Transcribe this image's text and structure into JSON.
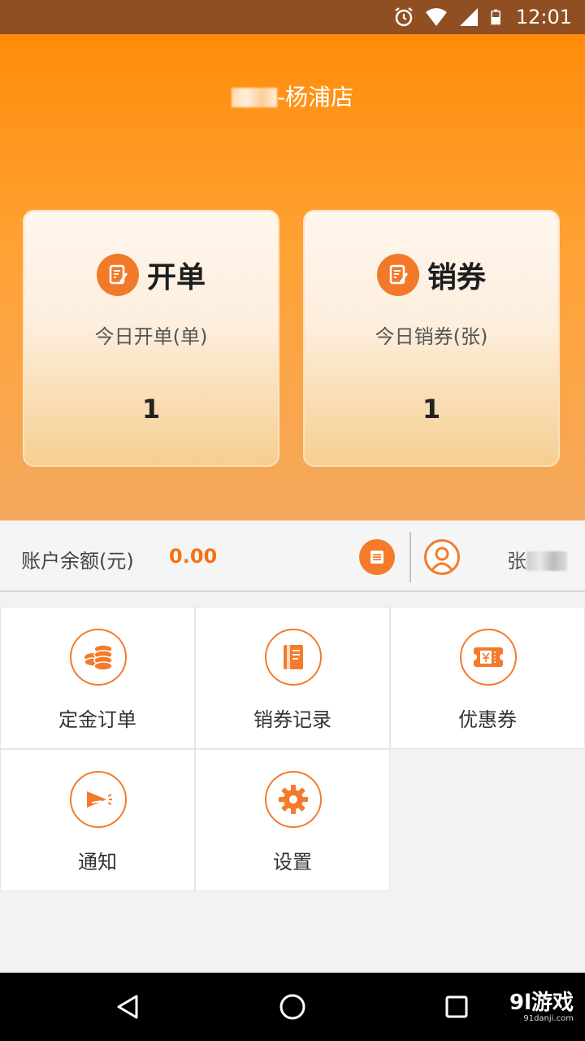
{
  "status_bar": {
    "time": "12:01"
  },
  "header": {
    "store_suffix": "-杨浦店",
    "cards": [
      {
        "title": "开单",
        "subtitle": "今日开单(单)",
        "value": "1",
        "icon": "notepad-icon"
      },
      {
        "title": "销券",
        "subtitle": "今日销券(张)",
        "value": "1",
        "icon": "notepad-icon"
      }
    ]
  },
  "account": {
    "label": "账户余额(元)",
    "value": "0.00",
    "user_prefix": "张"
  },
  "menu": [
    {
      "label": "定金订单",
      "icon": "coins-icon"
    },
    {
      "label": "销券记录",
      "icon": "book-icon"
    },
    {
      "label": "优惠券",
      "icon": "ticket-icon"
    },
    {
      "label": "通知",
      "icon": "megaphone-icon"
    },
    {
      "label": "设置",
      "icon": "gear-icon"
    }
  ],
  "watermark": {
    "logo": "9l游戏",
    "domain": "91danji.com"
  },
  "colors": {
    "accent": "#f47a2c",
    "header_top": "#ff8c0a",
    "status_bar": "#8f4f22"
  }
}
